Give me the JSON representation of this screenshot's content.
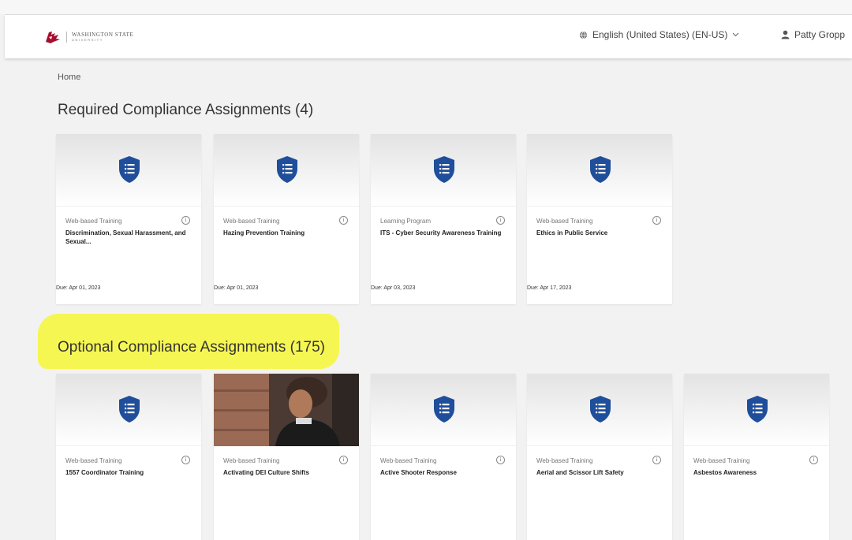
{
  "header": {
    "logo_text": "WASHINGTON STATE",
    "logo_sub": "UNIVERSITY",
    "language": "English (United States) (EN-US)",
    "user_name": "Patty Gropp"
  },
  "breadcrumb": "Home",
  "required": {
    "title": "Required Compliance Assignments (4)",
    "cards": [
      {
        "type": "Web-based Training",
        "title": "Discrimination, Sexual Harassment, and Sexual...",
        "due": "Due: Apr 01, 2023"
      },
      {
        "type": "Web-based Training",
        "title": "Hazing Prevention Training",
        "due": "Due: Apr 01, 2023"
      },
      {
        "type": "Learning Program",
        "title": "ITS - Cyber Security Awareness Training",
        "due": "Due: Apr 03, 2023"
      },
      {
        "type": "Web-based Training",
        "title": "Ethics in Public Service",
        "due": "Due: Apr 17, 2023"
      }
    ]
  },
  "optional": {
    "title": "Optional Compliance Assignments (175)",
    "cards": [
      {
        "type": "Web-based Training",
        "title": "1557 Coordinator Training"
      },
      {
        "type": "Web-based Training",
        "title": "Activating DEI Culture Shifts"
      },
      {
        "type": "Web-based Training",
        "title": "Active Shooter Response"
      },
      {
        "type": "Web-based Training",
        "title": "Aerial and Scissor Lift Safety"
      },
      {
        "type": "Web-based Training",
        "title": "Asbestos Awareness"
      }
    ]
  },
  "icons": {
    "card_thumb": "shield-list-icon",
    "info": "info-icon",
    "language": "globe-icon",
    "user": "user-icon",
    "chevron": "chevron-down-icon"
  },
  "colors": {
    "shield": "#1f4e9a",
    "highlight": "#f5f54a",
    "brand": "#a60f2d"
  }
}
